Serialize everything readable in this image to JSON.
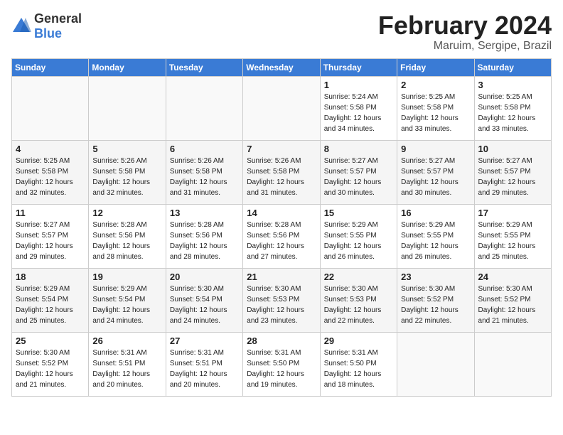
{
  "header": {
    "logo_general": "General",
    "logo_blue": "Blue",
    "month": "February 2024",
    "location": "Maruim, Sergipe, Brazil"
  },
  "weekdays": [
    "Sunday",
    "Monday",
    "Tuesday",
    "Wednesday",
    "Thursday",
    "Friday",
    "Saturday"
  ],
  "weeks": [
    [
      {
        "day": "",
        "info": ""
      },
      {
        "day": "",
        "info": ""
      },
      {
        "day": "",
        "info": ""
      },
      {
        "day": "",
        "info": ""
      },
      {
        "day": "1",
        "info": "Sunrise: 5:24 AM\nSunset: 5:58 PM\nDaylight: 12 hours\nand 34 minutes."
      },
      {
        "day": "2",
        "info": "Sunrise: 5:25 AM\nSunset: 5:58 PM\nDaylight: 12 hours\nand 33 minutes."
      },
      {
        "day": "3",
        "info": "Sunrise: 5:25 AM\nSunset: 5:58 PM\nDaylight: 12 hours\nand 33 minutes."
      }
    ],
    [
      {
        "day": "4",
        "info": "Sunrise: 5:25 AM\nSunset: 5:58 PM\nDaylight: 12 hours\nand 32 minutes."
      },
      {
        "day": "5",
        "info": "Sunrise: 5:26 AM\nSunset: 5:58 PM\nDaylight: 12 hours\nand 32 minutes."
      },
      {
        "day": "6",
        "info": "Sunrise: 5:26 AM\nSunset: 5:58 PM\nDaylight: 12 hours\nand 31 minutes."
      },
      {
        "day": "7",
        "info": "Sunrise: 5:26 AM\nSunset: 5:58 PM\nDaylight: 12 hours\nand 31 minutes."
      },
      {
        "day": "8",
        "info": "Sunrise: 5:27 AM\nSunset: 5:57 PM\nDaylight: 12 hours\nand 30 minutes."
      },
      {
        "day": "9",
        "info": "Sunrise: 5:27 AM\nSunset: 5:57 PM\nDaylight: 12 hours\nand 30 minutes."
      },
      {
        "day": "10",
        "info": "Sunrise: 5:27 AM\nSunset: 5:57 PM\nDaylight: 12 hours\nand 29 minutes."
      }
    ],
    [
      {
        "day": "11",
        "info": "Sunrise: 5:27 AM\nSunset: 5:57 PM\nDaylight: 12 hours\nand 29 minutes."
      },
      {
        "day": "12",
        "info": "Sunrise: 5:28 AM\nSunset: 5:56 PM\nDaylight: 12 hours\nand 28 minutes."
      },
      {
        "day": "13",
        "info": "Sunrise: 5:28 AM\nSunset: 5:56 PM\nDaylight: 12 hours\nand 28 minutes."
      },
      {
        "day": "14",
        "info": "Sunrise: 5:28 AM\nSunset: 5:56 PM\nDaylight: 12 hours\nand 27 minutes."
      },
      {
        "day": "15",
        "info": "Sunrise: 5:29 AM\nSunset: 5:55 PM\nDaylight: 12 hours\nand 26 minutes."
      },
      {
        "day": "16",
        "info": "Sunrise: 5:29 AM\nSunset: 5:55 PM\nDaylight: 12 hours\nand 26 minutes."
      },
      {
        "day": "17",
        "info": "Sunrise: 5:29 AM\nSunset: 5:55 PM\nDaylight: 12 hours\nand 25 minutes."
      }
    ],
    [
      {
        "day": "18",
        "info": "Sunrise: 5:29 AM\nSunset: 5:54 PM\nDaylight: 12 hours\nand 25 minutes."
      },
      {
        "day": "19",
        "info": "Sunrise: 5:29 AM\nSunset: 5:54 PM\nDaylight: 12 hours\nand 24 minutes."
      },
      {
        "day": "20",
        "info": "Sunrise: 5:30 AM\nSunset: 5:54 PM\nDaylight: 12 hours\nand 24 minutes."
      },
      {
        "day": "21",
        "info": "Sunrise: 5:30 AM\nSunset: 5:53 PM\nDaylight: 12 hours\nand 23 minutes."
      },
      {
        "day": "22",
        "info": "Sunrise: 5:30 AM\nSunset: 5:53 PM\nDaylight: 12 hours\nand 22 minutes."
      },
      {
        "day": "23",
        "info": "Sunrise: 5:30 AM\nSunset: 5:52 PM\nDaylight: 12 hours\nand 22 minutes."
      },
      {
        "day": "24",
        "info": "Sunrise: 5:30 AM\nSunset: 5:52 PM\nDaylight: 12 hours\nand 21 minutes."
      }
    ],
    [
      {
        "day": "25",
        "info": "Sunrise: 5:30 AM\nSunset: 5:52 PM\nDaylight: 12 hours\nand 21 minutes."
      },
      {
        "day": "26",
        "info": "Sunrise: 5:31 AM\nSunset: 5:51 PM\nDaylight: 12 hours\nand 20 minutes."
      },
      {
        "day": "27",
        "info": "Sunrise: 5:31 AM\nSunset: 5:51 PM\nDaylight: 12 hours\nand 20 minutes."
      },
      {
        "day": "28",
        "info": "Sunrise: 5:31 AM\nSunset: 5:50 PM\nDaylight: 12 hours\nand 19 minutes."
      },
      {
        "day": "29",
        "info": "Sunrise: 5:31 AM\nSunset: 5:50 PM\nDaylight: 12 hours\nand 18 minutes."
      },
      {
        "day": "",
        "info": ""
      },
      {
        "day": "",
        "info": ""
      }
    ]
  ]
}
